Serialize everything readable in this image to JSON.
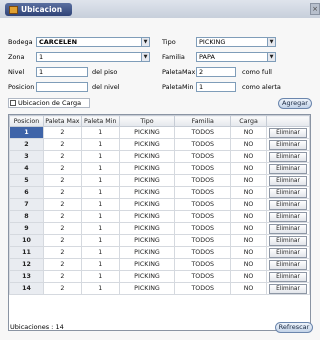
{
  "window": {
    "title": "Ubicacion",
    "close_glyph": "×"
  },
  "form": {
    "bodega": {
      "label": "Bodega",
      "value": "CARCELEN"
    },
    "zona": {
      "label": "Zona",
      "value": "1"
    },
    "nivel": {
      "label": "Nivel",
      "value": "1",
      "suffix": "del piso"
    },
    "posicion": {
      "label": "Posicion",
      "value": "",
      "suffix": "del nivel"
    },
    "tipo": {
      "label": "Tipo",
      "value": "PICKING"
    },
    "familia": {
      "label": "Familia",
      "value": "PAPA"
    },
    "paletamax": {
      "label": "PaletaMax",
      "value": "2",
      "suffix": "como full"
    },
    "paletamin": {
      "label": "PaletaMin",
      "value": "1",
      "suffix": "como alerta"
    },
    "ubicacion_carga": {
      "label": "Ubicacion de Carga",
      "checked": false
    },
    "agregar_label": "Agregar"
  },
  "table": {
    "columns": [
      "Posicion",
      "Paleta Max",
      "Paleta Min",
      "Tipo",
      "Familia",
      "Carga",
      ""
    ],
    "button_label": "Eliminar",
    "rows": [
      [
        "1",
        "2",
        "1",
        "PICKING",
        "TODOS",
        "NO"
      ],
      [
        "2",
        "2",
        "1",
        "PICKING",
        "TODOS",
        "NO"
      ],
      [
        "3",
        "2",
        "1",
        "PICKING",
        "TODOS",
        "NO"
      ],
      [
        "4",
        "2",
        "1",
        "PICKING",
        "TODOS",
        "NO"
      ],
      [
        "5",
        "2",
        "1",
        "PICKING",
        "TODOS",
        "NO"
      ],
      [
        "6",
        "2",
        "1",
        "PICKING",
        "TODOS",
        "NO"
      ],
      [
        "7",
        "2",
        "1",
        "PICKING",
        "TODOS",
        "NO"
      ],
      [
        "8",
        "2",
        "1",
        "PICKING",
        "TODOS",
        "NO"
      ],
      [
        "9",
        "2",
        "1",
        "PICKING",
        "TODOS",
        "NO"
      ],
      [
        "10",
        "2",
        "1",
        "PICKING",
        "TODOS",
        "NO"
      ],
      [
        "11",
        "2",
        "1",
        "PICKING",
        "TODOS",
        "NO"
      ],
      [
        "12",
        "2",
        "1",
        "PICKING",
        "TODOS",
        "NO"
      ],
      [
        "13",
        "2",
        "1",
        "PICKING",
        "TODOS",
        "NO"
      ],
      [
        "14",
        "2",
        "1",
        "PICKING",
        "TODOS",
        "NO"
      ]
    ]
  },
  "footer": {
    "count_label": "Ubicaciones :",
    "count": "14",
    "refresh_label": "Refrescar"
  }
}
